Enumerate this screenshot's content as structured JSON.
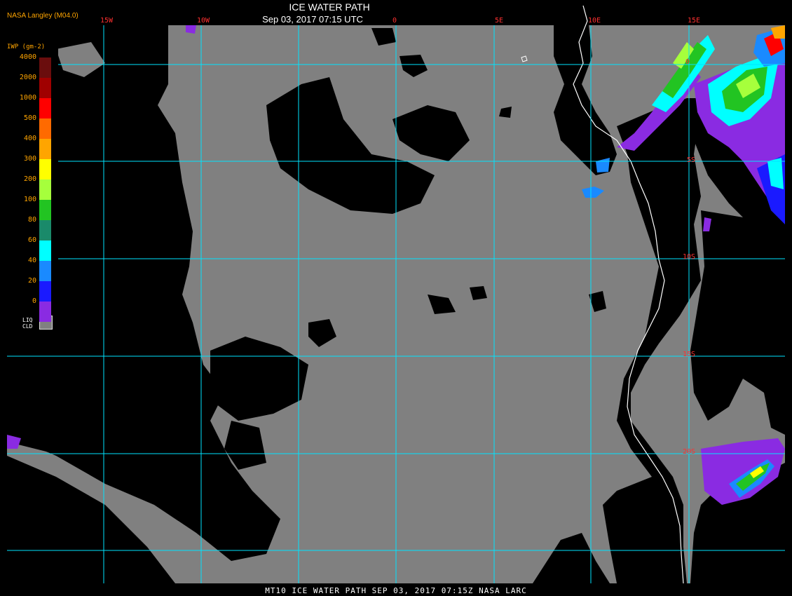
{
  "header": {
    "title": "ICE WATER PATH",
    "subtitle": "Sep 03, 2017 07:15 UTC",
    "credit": "NASA Langley (M04.0)"
  },
  "footer": {
    "text": "MT10  ICE WATER PATH   SEP 03, 2017 07:15Z   NASA LARC"
  },
  "map": {
    "longitude_labels": [
      "15W",
      "10W",
      "0",
      "5E",
      "10E",
      "15E"
    ],
    "latitude_labels": [
      "0",
      "5S",
      "10S",
      "15S",
      "20S"
    ],
    "colors": {
      "clear_sky": "#000000",
      "liquid_cloud": "#808080",
      "gridline": "#00e5ff",
      "coastline": "#ffffff",
      "label": "#ff3030"
    }
  },
  "legend": {
    "title": "IWP (gm-2)",
    "ticks": [
      "4000",
      "2000",
      "1000",
      "500",
      "400",
      "300",
      "200",
      "100",
      "80",
      "60",
      "40",
      "20",
      "0"
    ],
    "swatches": [
      "#6a0d0d",
      "#a00000",
      "#ff0000",
      "#ff6a00",
      "#ffa500",
      "#ffff00",
      "#a6ff3c",
      "#22c422",
      "#1a8a6a",
      "#00ffff",
      "#1a8aff",
      "#1a1aff",
      "#8a2be2"
    ],
    "liquid_label_1": "LIQ",
    "liquid_label_2": "CLD",
    "liquid_color": "#808080"
  }
}
